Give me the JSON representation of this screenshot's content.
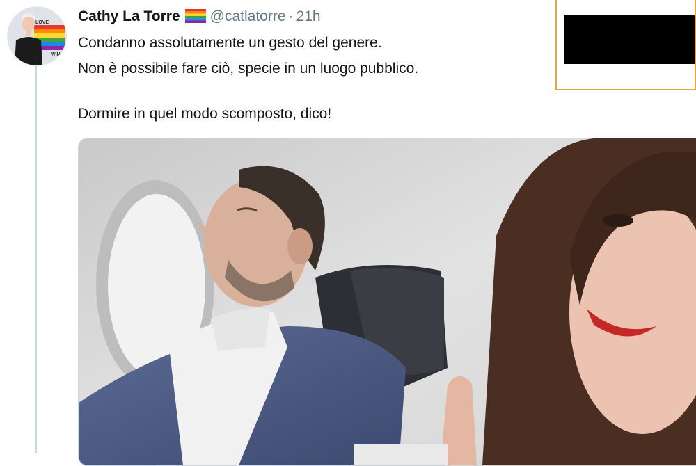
{
  "tweet": {
    "author_name": "Cathy La Torre",
    "flag_icon": "rainbow-flag",
    "handle": "@catlatorre",
    "separator": "·",
    "timestamp": "21h",
    "text_lines": [
      "Condanno assolutamente un gesto del genere.",
      "Non è possibile fare ciò, specie in un luogo pubblico.",
      "Dormire in quel modo scomposto, dico!"
    ],
    "avatar_text": [
      "LOVE",
      "WINS"
    ],
    "media": {
      "type": "photo"
    }
  },
  "colors": {
    "text": "#14171a",
    "secondary": "#657786",
    "thread_line": "#ccd6dd",
    "overlay_border": "#e8a33b"
  }
}
